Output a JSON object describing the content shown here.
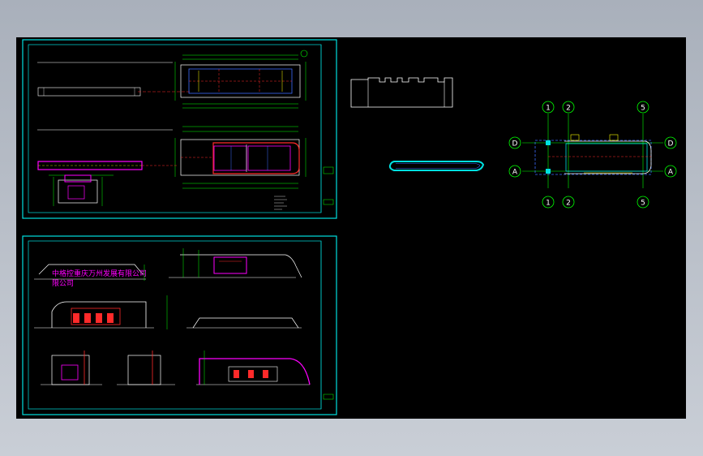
{
  "drawing": {
    "background": "#000000",
    "colors": {
      "frame": "#00e0e0",
      "line_white": "#ffffff",
      "line_green": "#00ff00",
      "line_blue": "#3c6cff",
      "line_red": "#ff2a2a",
      "line_magenta": "#ff00ff",
      "line_yellow": "#ffff00"
    },
    "elevation_company_text": "中格控重庆万州发展有限公司",
    "grid_labels": {
      "columns": [
        "1",
        "2",
        "5"
      ],
      "rows": [
        "D",
        "A"
      ]
    }
  }
}
